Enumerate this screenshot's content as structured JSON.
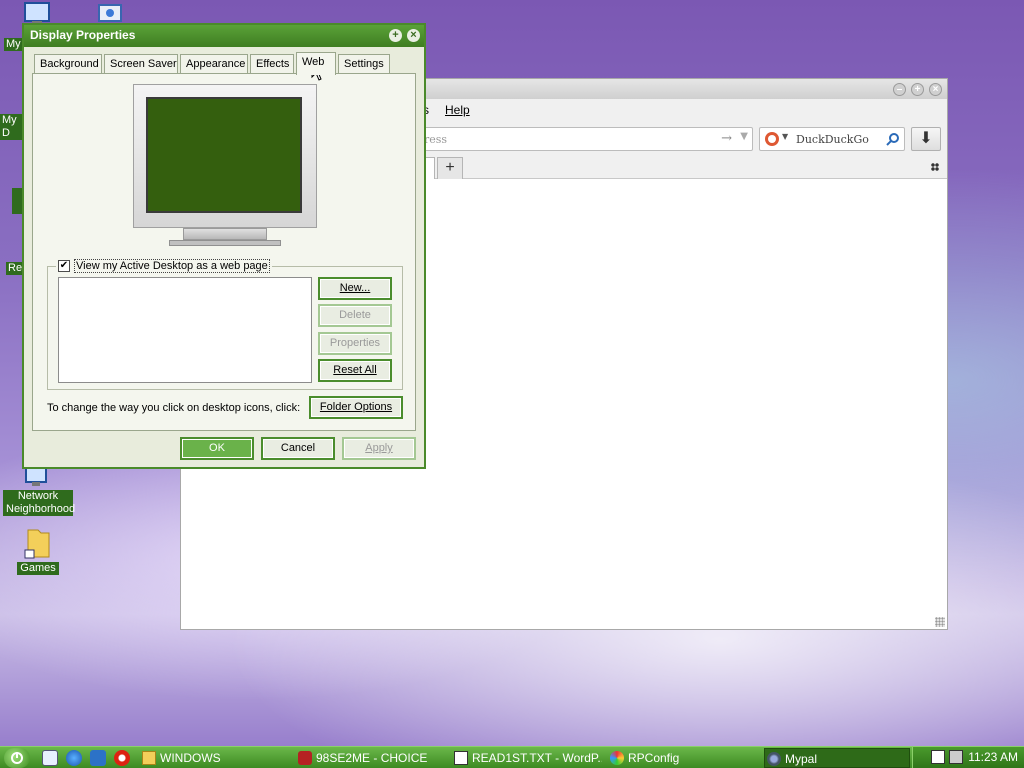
{
  "desktop": {
    "icons": [
      {
        "label": "My"
      },
      {
        "label": "My D"
      },
      {
        "label": "Re"
      },
      {
        "label": "Network Neighborhood"
      },
      {
        "label": "Games"
      }
    ]
  },
  "browser": {
    "menu_help": "Help",
    "menu_partial": "s",
    "address_placeholder": "ress",
    "search_engine": "DuckDuckGo",
    "new_tab": "+"
  },
  "dialog": {
    "title": "Display Properties",
    "tabs": [
      "Background",
      "Screen Saver",
      "Appearance",
      "Effects",
      "Web",
      "Settings"
    ],
    "active_tab": "Web",
    "active_desktop_checkbox": "View my Active Desktop as a web page",
    "active_desktop_checked": true,
    "buttons": {
      "new": "New...",
      "delete": "Delete",
      "properties": "Properties",
      "reset_all": "Reset All"
    },
    "folder_options_prompt": "To change the way you click on desktop icons, click:",
    "folder_options": "Folder Options",
    "ok": "OK",
    "cancel": "Cancel",
    "apply": "Apply",
    "screen_color": "#345f0e"
  },
  "taskbar": {
    "items": [
      {
        "label": "WINDOWS",
        "icon": "folder-icon"
      },
      {
        "label": "98SE2ME - CHOICE",
        "icon": "car-icon"
      },
      {
        "label": "READ1ST.TXT - WordP...",
        "icon": "document-icon"
      },
      {
        "label": "RPConfig",
        "icon": "config-icon"
      },
      {
        "label": "Mypal",
        "icon": "browser-icon"
      }
    ],
    "clock": "11:23 AM"
  }
}
